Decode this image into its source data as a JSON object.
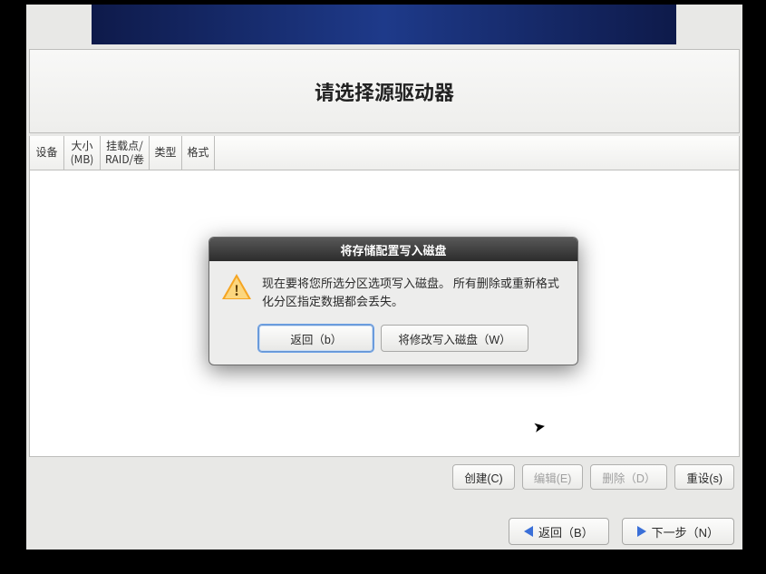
{
  "header": {
    "title": "请选择源驱动器"
  },
  "columns": {
    "device": "设备",
    "size": "大小\n(MB)",
    "mount": "挂载点/\nRAID/卷",
    "type": "类型",
    "format": "格式"
  },
  "actions": {
    "create": "创建(C)",
    "edit": "编辑(E)",
    "delete": "删除（D）",
    "reset": "重设(s)"
  },
  "nav": {
    "back": "返回（B）",
    "next": "下一步（N）"
  },
  "dialog": {
    "title": "将存储配置写入磁盘",
    "message": "现在要将您所选分区选项写入磁盘。 所有删除或重新格式化分区指定数据都会丢失。",
    "back_btn": "返回（b）",
    "write_btn": "将修改写入磁盘（W）"
  }
}
